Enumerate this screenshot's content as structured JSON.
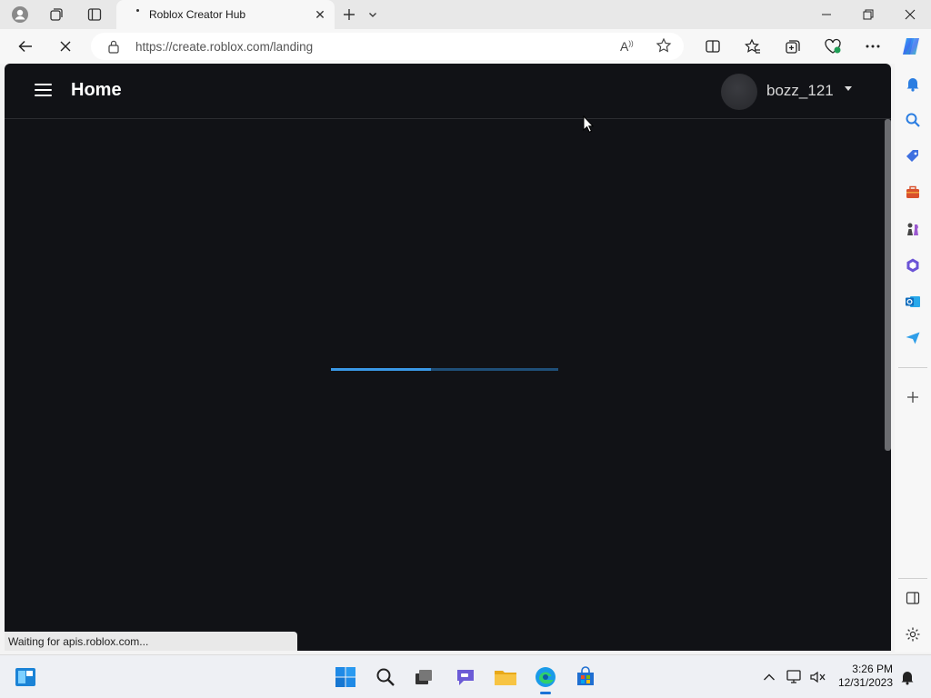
{
  "browser": {
    "tab_title": "Roblox Creator Hub",
    "url": "https://create.roblox.com/landing",
    "status_text": "Waiting for apis.roblox.com..."
  },
  "page": {
    "title": "Home",
    "username": "bozz_121",
    "loading_progress": 0.44
  },
  "taskbar": {
    "time": "3:26 PM",
    "date": "12/31/2023"
  },
  "colors": {
    "page_background": "#111216",
    "loader_track": "#1f4f78",
    "loader_fill": "#3a98e6"
  }
}
